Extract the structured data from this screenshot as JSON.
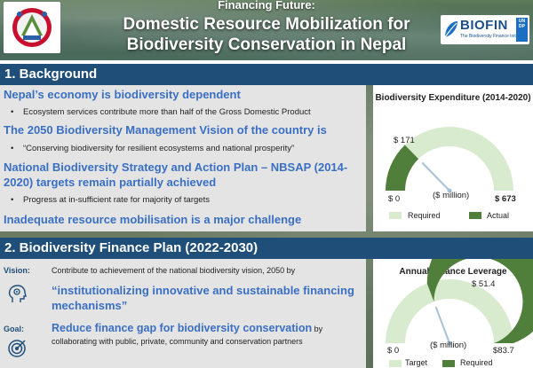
{
  "header": {
    "kicker": "Financing Future:",
    "title": "Domestic Resource Mobilization for Biodiversity Conservation in Nepal",
    "partner_logo": {
      "name": "BIOFIN",
      "tagline": "The Biodiversity Finance Initiative"
    },
    "undp_logo_text": "UN DP"
  },
  "section1": {
    "title": "1.  Background",
    "items": [
      {
        "heading": "Nepal’s economy is biodiversity dependent",
        "bullet": "Ecosystem services contribute more than half of the Gross Domestic Product"
      },
      {
        "heading": "The 2050 Biodiversity Management Vision of the country is",
        "bullet": "“Conserving biodiversity for resilient ecosystems and national prosperity”"
      },
      {
        "heading": "National Biodiversity Strategy and Action Plan – NBSAP (2014-2020) targets remain partially achieved",
        "bullet": "Progress at in-sufficient rate for majority of targets"
      },
      {
        "heading": "Inadequate resource mobilisation is a major challenge"
      }
    ],
    "gauge": {
      "title": "Biodiversity Expenditure (2014-2020)",
      "min_label": "$ 0",
      "mid_label": "$ 171",
      "max_label": "$ 673",
      "unit": "($ million)",
      "required": 673,
      "actual": 171,
      "legend": [
        "Required",
        "Actual"
      ]
    }
  },
  "section2": {
    "title": "2.  Biodiversity Finance Plan (2022-2030)",
    "vision": {
      "label": "Vision:",
      "text": "Contribute to achievement of the national biodiversity vision, 2050 by",
      "quote": "“institutionalizing innovative and sustainable financing mechanisms”"
    },
    "goal": {
      "label": "Goal:",
      "strong": "Reduce finance gap for biodiversity conservation",
      "rest": " by collaborating with public, private, community and conservation partners"
    },
    "gauge": {
      "title": "Annual Finance Leverage",
      "min_label": "$ 0",
      "mid_label": "$ 51.4",
      "max_label": "$83.7",
      "unit": "($ million)",
      "target": 83.7,
      "required": 51.4,
      "legend": [
        "Target",
        "Required"
      ]
    }
  },
  "colors": {
    "section_bar": "#1f4e79",
    "heading_blue": "#3a6fc4",
    "gauge_light": "#d9ebcf",
    "gauge_dark": "#4f7f3a",
    "needle": "#a7c1d6"
  },
  "icons": [
    "government-emblem",
    "head-gears-icon",
    "target-icon"
  ]
}
